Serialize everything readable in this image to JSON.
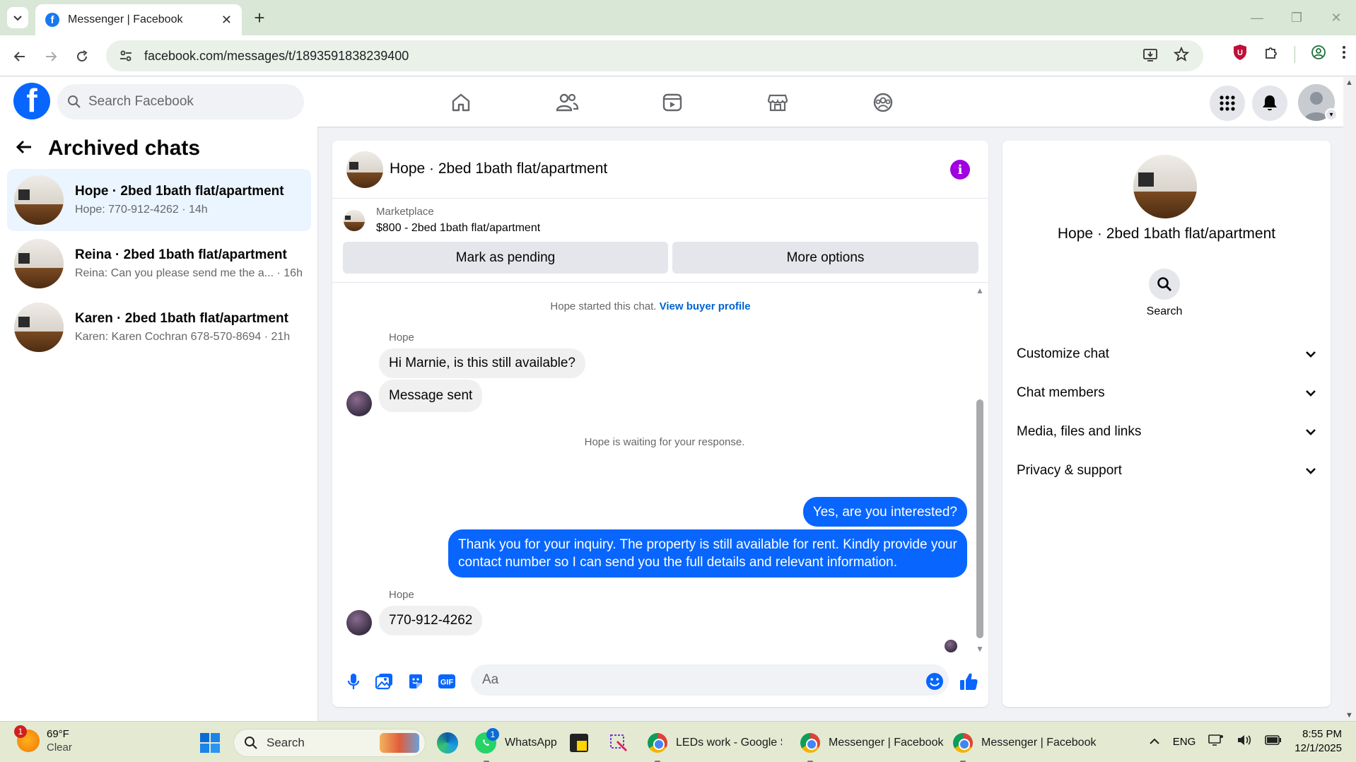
{
  "browser": {
    "tab_title": "Messenger | Facebook",
    "favicon_letter": "f",
    "new_tab": "+",
    "url": "facebook.com/messages/t/1893591838239400",
    "window_controls": {
      "minimize": "—",
      "maximize": "❐",
      "close": "✕"
    }
  },
  "fb": {
    "logo_letter": "f",
    "search_placeholder": "Search Facebook",
    "nav": [
      "home-icon",
      "friends-icon",
      "video-icon",
      "marketplace-icon",
      "groups-icon"
    ]
  },
  "left": {
    "title": "Archived chats",
    "chats": [
      {
        "name": "Hope · 2bed 1bath flat/apartment",
        "preview": "Hope: 770-912-4262 · 14h",
        "active": true
      },
      {
        "name": "Reina · 2bed 1bath flat/apartment",
        "preview": "Reina: Can you please send me the a... · 16h",
        "active": false
      },
      {
        "name": "Karen · 2bed 1bath flat/apartment",
        "preview": "Karen: Karen Cochran 678-570-8694 · 21h",
        "active": false
      }
    ]
  },
  "conversation": {
    "title": "Hope · 2bed 1bath flat/apartment",
    "info_letter": "i",
    "marketplace_label": "Marketplace",
    "listing": "$800 - 2bed 1bath flat/apartment",
    "mark_pending": "Mark as pending",
    "more_options": "More options",
    "started_text": "Hope started this chat.",
    "view_buyer": "View buyer profile",
    "sender_1": "Hope",
    "msg_1": "Hi Marnie, is this still available?",
    "msg_2": "Message sent",
    "waiting_text": "Hope is waiting for your response.",
    "reply_1": "Yes, are you interested?",
    "reply_2": "Thank you for your inquiry. The property is still available for rent. Kindly provide your contact number so I can send you the full details and relevant information.",
    "sender_2": "Hope",
    "msg_3": "770-912-4262",
    "composer_placeholder": "Aa"
  },
  "info_panel": {
    "name": "Hope · 2bed 1bath flat/apartment",
    "search_label": "Search",
    "rows": [
      "Customize chat",
      "Chat members",
      "Media, files and links",
      "Privacy & support"
    ]
  },
  "taskbar": {
    "temp": "69°F",
    "weather": "Clear",
    "weather_badge": "1",
    "search": "Search",
    "whatsapp": "WhatsApp",
    "whatsapp_badge": "1",
    "chrome_1": "LEDs work - Google Sh",
    "chrome_2": "Messenger | Facebook",
    "chrome_3": "Messenger | Facebook",
    "lang": "ENG",
    "time": "8:55 PM",
    "date": "12/1/2025"
  },
  "colors": {
    "accent": "#0866ff",
    "info": "#a000e0",
    "active_chat": "#ebf5ff"
  }
}
